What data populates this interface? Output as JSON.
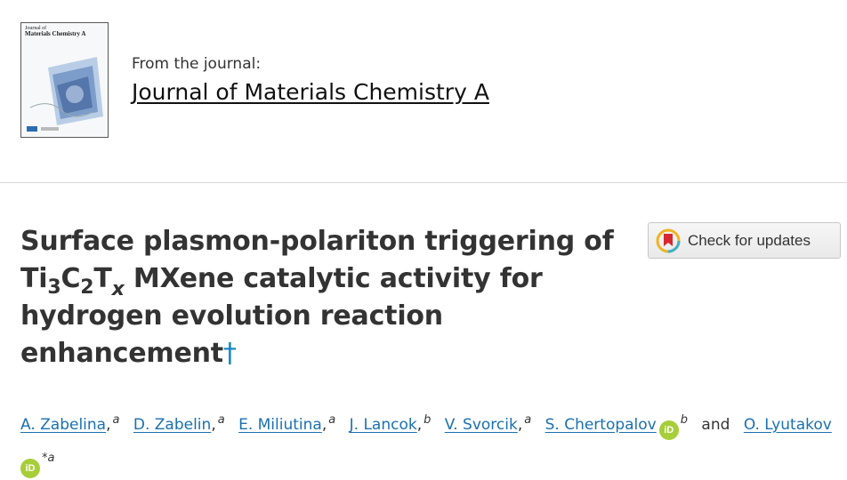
{
  "journal": {
    "from_label": "From the journal:",
    "name": "Journal of Materials Chemistry A",
    "cover_title_line1": "Journal of",
    "cover_title_line2": "Materials Chemistry A"
  },
  "article": {
    "title_part1": "Surface plasmon-polariton triggering of Ti",
    "sub1": "3",
    "mid1": "C",
    "sub2": "2",
    "mid2": "T",
    "sub3": "x",
    "title_part2": " MXene catalytic activity for hydrogen evolution reaction enhancement",
    "dagger": "†"
  },
  "check_updates": {
    "label": "Check for updates"
  },
  "authors": [
    {
      "name": "A. Zabelina",
      "affil": "a"
    },
    {
      "name": "D. Zabelin",
      "affil": "a"
    },
    {
      "name": "E. Miliutina",
      "affil": "a"
    },
    {
      "name": "J. Lancok",
      "affil": "b"
    },
    {
      "name": "V. Svorcik",
      "affil": "a"
    },
    {
      "name": "S. Chertopalov",
      "affil": "b",
      "orcid": true
    },
    {
      "name": "O. Lyutakov",
      "affil": "*a",
      "orcid": true
    }
  ],
  "and_word": "and",
  "orcid_label": "iD",
  "colors": {
    "link": "#1a70b0",
    "dagger": "#1b87c4",
    "orcid": "#a6ce39"
  }
}
